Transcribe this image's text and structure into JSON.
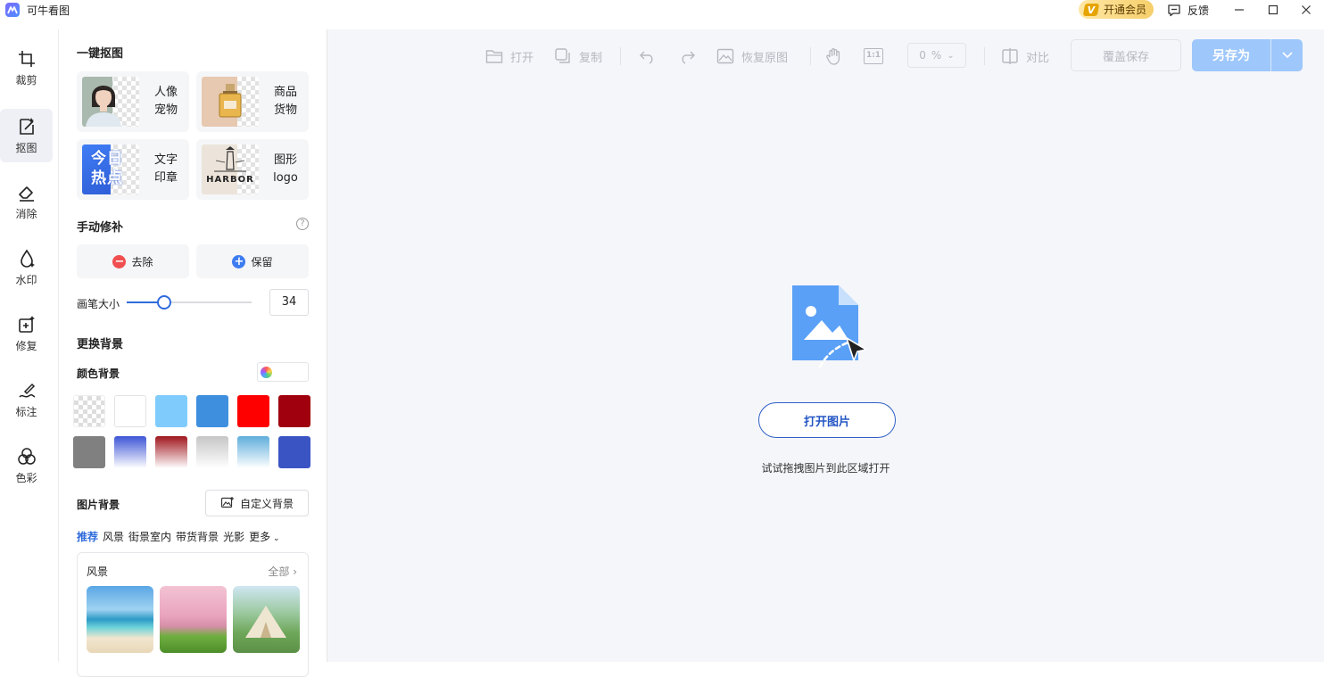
{
  "app": {
    "title": "可牛看图"
  },
  "titlebar": {
    "vip_badge": "V",
    "vip_label": "开通会员",
    "feedback_label": "反馈"
  },
  "rail": {
    "items": [
      {
        "label": "裁剪",
        "icon": "crop-icon",
        "active": false
      },
      {
        "label": "抠图",
        "icon": "cutout-icon",
        "active": true
      },
      {
        "label": "消除",
        "icon": "eraser-icon",
        "active": false
      },
      {
        "label": "水印",
        "icon": "watermark-icon",
        "active": false
      },
      {
        "label": "修复",
        "icon": "repair-icon",
        "active": false
      },
      {
        "label": "标注",
        "icon": "annotate-icon",
        "active": false
      },
      {
        "label": "色彩",
        "icon": "color-icon",
        "active": false
      }
    ]
  },
  "panel": {
    "one_click_title": "一键抠图",
    "cards": [
      {
        "line1": "人像",
        "line2": "宠物",
        "thumb": "portrait"
      },
      {
        "line1": "商品",
        "line2": "货物",
        "thumb": "perfume"
      },
      {
        "line1": "文字",
        "line2": "印章",
        "thumb": "text",
        "thumb_text": "今日热点"
      },
      {
        "line1": "图形",
        "line2": "logo",
        "thumb": "logo",
        "thumb_text": "HARBOR"
      }
    ],
    "manual_title": "手动修补",
    "remove_label": "去除",
    "keep_label": "保留",
    "brush_label": "画笔大小",
    "brush_value": "34",
    "brush_fraction": 0.3,
    "replace_bg_title": "更换背景",
    "color_bg_title": "颜色背景",
    "swatches": [
      "transparent",
      "#ffffff",
      "#7fccfc",
      "#3f8fdf",
      "#ff0000",
      "#a0000e",
      "#808080",
      "gradient-blue",
      "gradient-red",
      "gradient-gray",
      "gradient-sky",
      "#3a54c4"
    ],
    "image_bg_title": "图片背景",
    "custom_bg_label": "自定义背景",
    "tabs": [
      "推荐",
      "风景",
      "街景室内",
      "带货背景",
      "光影",
      "更多"
    ],
    "gallery": {
      "title": "风景",
      "all_label": "全部"
    }
  },
  "toolbar": {
    "open_label": "打开",
    "copy_label": "复制",
    "restore_label": "恢复原图",
    "ratio_label": "1:1",
    "zoom_value": "0",
    "zoom_unit": "%",
    "compare_label": "对比",
    "overwrite_label": "覆盖保存",
    "saveas_label": "另存为"
  },
  "canvas": {
    "open_button": "打开图片",
    "drop_hint": "试试拖拽图片到此区域打开"
  },
  "colors": {
    "accent": "#2f6bdc",
    "saveas": "#9ec7fb",
    "canvas_bg": "#f5f6fa"
  }
}
